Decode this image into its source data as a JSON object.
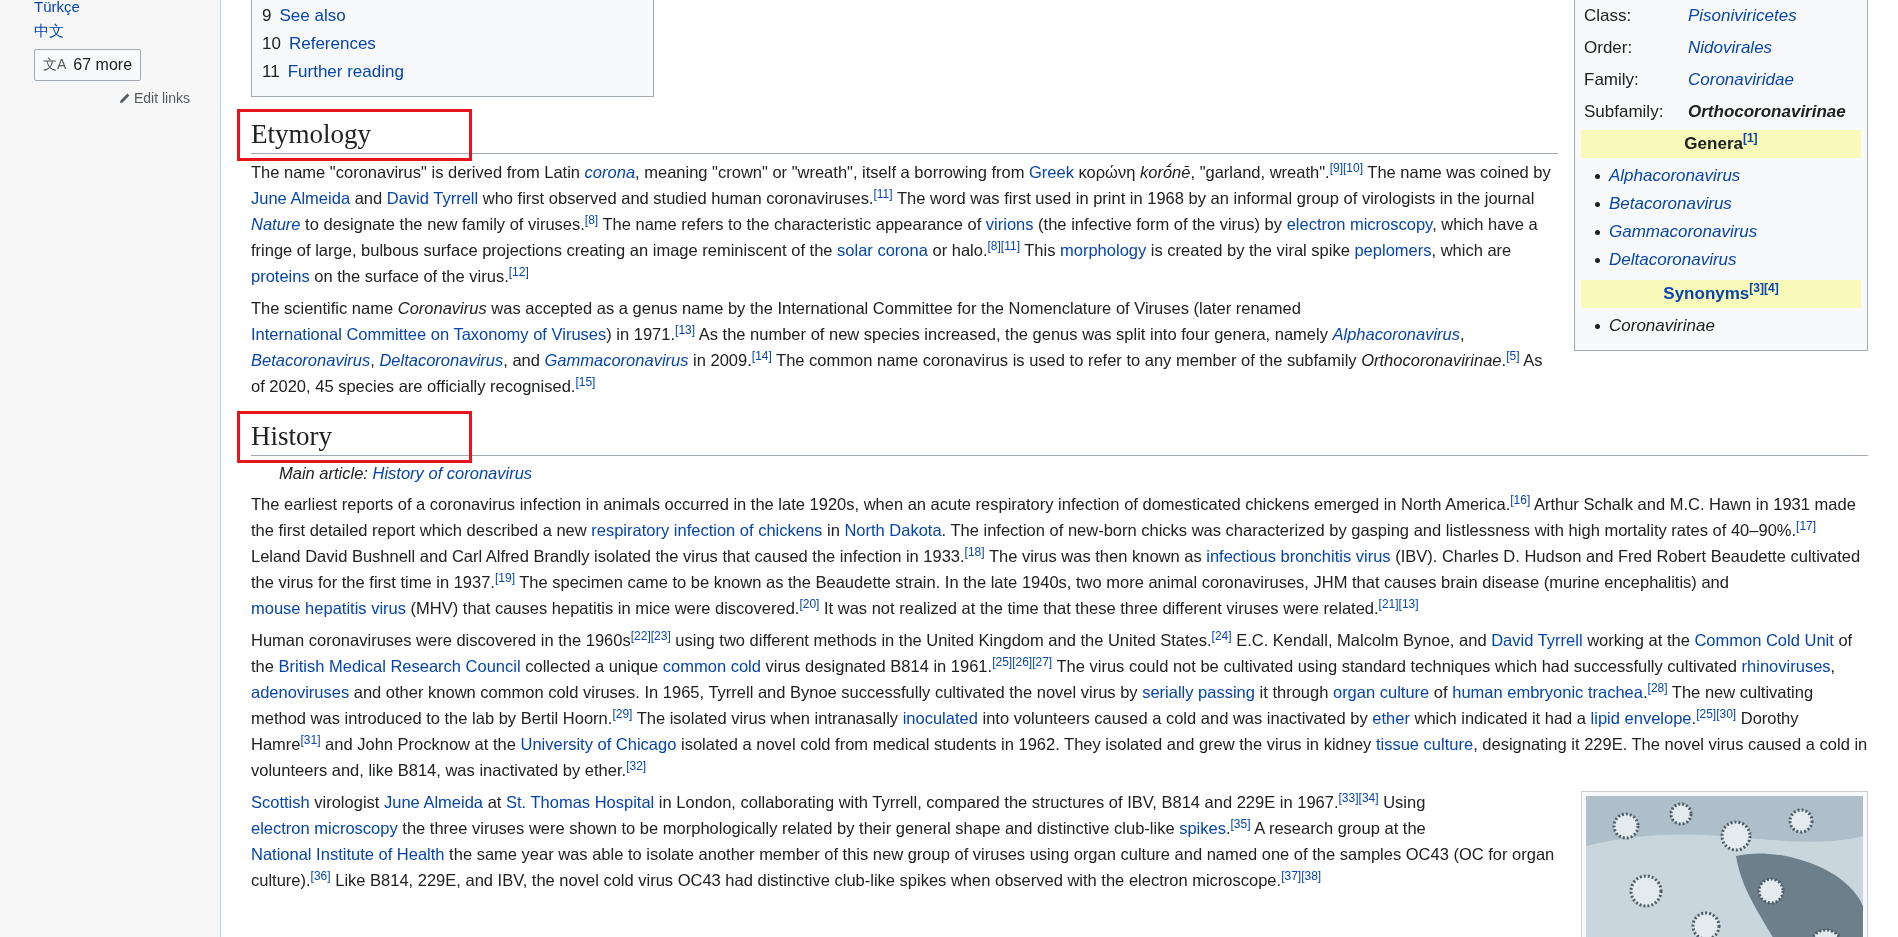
{
  "sidebar": {
    "languages": [
      {
        "label": "Türkçe"
      },
      {
        "label": "中文"
      }
    ],
    "more_button": {
      "icon": "文A",
      "label": "67 more"
    },
    "edit_links": {
      "label": "Edit links"
    }
  },
  "toc": {
    "items": [
      {
        "number": "9",
        "label": "See also"
      },
      {
        "number": "10",
        "label": "References"
      },
      {
        "number": "11",
        "label": "Further reading"
      }
    ]
  },
  "infobox": {
    "rows": [
      {
        "label": "Class:",
        "value": "Pisoniviricetes",
        "kind": "link"
      },
      {
        "label": "Order:",
        "value": "Nidovirales",
        "kind": "link"
      },
      {
        "label": "Family:",
        "value": "Coronaviridae",
        "kind": "link"
      },
      {
        "label": "Subfamily:",
        "value": "Orthocoronavirinae",
        "kind": "current"
      }
    ],
    "groups": [
      {
        "header": "Genera",
        "header_link": false,
        "cites": [
          "[1]"
        ],
        "items": [
          {
            "text": "Alphacoronavirus",
            "link": true
          },
          {
            "text": "Betacoronavirus",
            "link": true
          },
          {
            "text": "Gammacoronavirus",
            "link": true
          },
          {
            "text": "Deltacoronavirus",
            "link": true
          }
        ]
      },
      {
        "header": "Synonyms",
        "header_link": true,
        "cites": [
          "[3]",
          "[4]"
        ],
        "items": [
          {
            "text": "Coronavirinae",
            "link": false
          }
        ]
      }
    ]
  },
  "sections": [
    {
      "heading": {
        "text": "Etymology",
        "highlighted": true
      },
      "paragraphs": [
        {
          "runs": [
            {
              "kind": "text",
              "text": "The name \"coronavirus\" is derived from Latin "
            },
            {
              "kind": "link",
              "text": "corona",
              "italic": true
            },
            {
              "kind": "text",
              "text": ", meaning \"crown\" or \"wreath\", itself a borrowing from "
            },
            {
              "kind": "link",
              "text": "Greek"
            },
            {
              "kind": "text",
              "text": " κορώνη *korṓnē*, \"garland, wreath\"."
            },
            {
              "kind": "cite",
              "text": "[9]"
            },
            {
              "kind": "cite",
              "text": "[10]"
            },
            {
              "kind": "text",
              "text": " The name was coined by "
            },
            {
              "kind": "link",
              "text": "June Almeida"
            },
            {
              "kind": "text",
              "text": " and "
            },
            {
              "kind": "link",
              "text": "David Tyrrell"
            },
            {
              "kind": "text",
              "text": " who first observed and studied human coronaviruses."
            },
            {
              "kind": "cite",
              "text": "[11]"
            },
            {
              "kind": "text",
              "text": " The word was first used in print in 1968 by an informal group of virologists in the journal "
            },
            {
              "kind": "link",
              "text": "Nature",
              "italic": true
            },
            {
              "kind": "text",
              "text": " to designate the new family of viruses."
            },
            {
              "kind": "cite",
              "text": "[8]"
            },
            {
              "kind": "text",
              "text": " The name refers to the characteristic appearance of "
            },
            {
              "kind": "link",
              "text": "virions"
            },
            {
              "kind": "text",
              "text": " (the infective form of the virus) by "
            },
            {
              "kind": "link",
              "text": "electron microscopy"
            },
            {
              "kind": "text",
              "text": ", which have a fringe of large, bulbous surface projections creating an image reminiscent of the "
            },
            {
              "kind": "link",
              "text": "solar corona"
            },
            {
              "kind": "text",
              "text": " or halo."
            },
            {
              "kind": "cite",
              "text": "[8]"
            },
            {
              "kind": "cite",
              "text": "[11]"
            },
            {
              "kind": "text",
              "text": " This "
            },
            {
              "kind": "link",
              "text": "morphology"
            },
            {
              "kind": "text",
              "text": " is created by the viral spike "
            },
            {
              "kind": "link",
              "text": "peplomers"
            },
            {
              "kind": "text",
              "text": ", which are "
            },
            {
              "kind": "link",
              "text": "proteins"
            },
            {
              "kind": "text",
              "text": " on the surface of the virus."
            },
            {
              "kind": "cite",
              "text": "[12]"
            }
          ]
        },
        {
          "runs": [
            {
              "kind": "text",
              "text": "The scientific name *Coronavirus* was accepted as a genus name by the International Committee for the Nomenclature of Viruses (later renamed "
            },
            {
              "kind": "link",
              "text": "International Committee on Taxonomy of Viruses"
            },
            {
              "kind": "text",
              "text": ") in 1971."
            },
            {
              "kind": "cite",
              "text": "[13]"
            },
            {
              "kind": "text",
              "text": " As the number of new species increased, the genus was split into four genera, namely "
            },
            {
              "kind": "link",
              "text": "Alphacoronavirus",
              "italic": true
            },
            {
              "kind": "text",
              "text": ", "
            },
            {
              "kind": "link",
              "text": "Betacoronavirus",
              "italic": true
            },
            {
              "kind": "text",
              "text": ", "
            },
            {
              "kind": "link",
              "text": "Deltacoronavirus",
              "italic": true
            },
            {
              "kind": "text",
              "text": ", and "
            },
            {
              "kind": "link",
              "text": "Gammacoronavirus",
              "italic": true
            },
            {
              "kind": "text",
              "text": " in 2009."
            },
            {
              "kind": "cite",
              "text": "[14]"
            },
            {
              "kind": "text",
              "text": " The common name coronavirus is used to refer to any member of the subfamily *Orthocoronavirinae*."
            },
            {
              "kind": "cite",
              "text": "[5]"
            },
            {
              "kind": "text",
              "text": " As of 2020, 45 species are officially recognised."
            },
            {
              "kind": "cite",
              "text": "[15]"
            }
          ]
        }
      ]
    },
    {
      "heading": {
        "text": "History",
        "highlighted": true
      },
      "hatnote": {
        "label": "Main article:",
        "link": "History of coronavirus"
      },
      "paragraphs": [
        {
          "runs": [
            {
              "kind": "text",
              "text": "The earliest reports of a coronavirus infection in animals occurred in the late 1920s, when an acute respiratory infection of domesticated chickens emerged in North America."
            },
            {
              "kind": "cite",
              "text": "[16]"
            },
            {
              "kind": "text",
              "text": " Arthur Schalk and M.C. Hawn in 1931 made the first detailed report which described a new "
            },
            {
              "kind": "link",
              "text": "respiratory infection of chickens"
            },
            {
              "kind": "text",
              "text": " in "
            },
            {
              "kind": "link",
              "text": "North Dakota"
            },
            {
              "kind": "text",
              "text": ". The infection of new-born chicks was characterized by gasping and listlessness with high mortality rates of 40–90%."
            },
            {
              "kind": "cite",
              "text": "[17]"
            },
            {
              "kind": "text",
              "text": " Leland David Bushnell and Carl Alfred Brandly isolated the virus that caused the infection in 1933."
            },
            {
              "kind": "cite",
              "text": "[18]"
            },
            {
              "kind": "text",
              "text": " The virus was then known as "
            },
            {
              "kind": "link",
              "text": "infectious bronchitis virus"
            },
            {
              "kind": "text",
              "text": " (IBV). Charles D. Hudson and Fred Robert Beaudette cultivated the virus for the first time in 1937."
            },
            {
              "kind": "cite",
              "text": "[19]"
            },
            {
              "kind": "text",
              "text": " The specimen came to be known as the Beaudette strain. In the late 1940s, two more animal coronaviruses, JHM that causes brain disease (murine encephalitis) and "
            },
            {
              "kind": "link",
              "text": "mouse hepatitis virus"
            },
            {
              "kind": "text",
              "text": " (MHV) that causes hepatitis in mice were discovered."
            },
            {
              "kind": "cite",
              "text": "[20]"
            },
            {
              "kind": "text",
              "text": " It was not realized at the time that these three different viruses were related."
            },
            {
              "kind": "cite",
              "text": "[21]"
            },
            {
              "kind": "cite",
              "text": "[13]"
            }
          ]
        },
        {
          "runs": [
            {
              "kind": "text",
              "text": "Human coronaviruses were discovered in the 1960s"
            },
            {
              "kind": "cite",
              "text": "[22]"
            },
            {
              "kind": "cite",
              "text": "[23]"
            },
            {
              "kind": "text",
              "text": " using two different methods in the United Kingdom and the United States."
            },
            {
              "kind": "cite",
              "text": "[24]"
            },
            {
              "kind": "text",
              "text": " E.C. Kendall, Malcolm Bynoe, and "
            },
            {
              "kind": "link",
              "text": "David Tyrrell"
            },
            {
              "kind": "text",
              "text": " working at the "
            },
            {
              "kind": "link",
              "text": "Common Cold Unit"
            },
            {
              "kind": "text",
              "text": " of the "
            },
            {
              "kind": "link",
              "text": "British Medical Research Council"
            },
            {
              "kind": "text",
              "text": " collected a unique "
            },
            {
              "kind": "link",
              "text": "common cold"
            },
            {
              "kind": "text",
              "text": " virus designated B814 in 1961."
            },
            {
              "kind": "cite",
              "text": "[25]"
            },
            {
              "kind": "cite",
              "text": "[26]"
            },
            {
              "kind": "cite",
              "text": "[27]"
            },
            {
              "kind": "text",
              "text": " The virus could not be cultivated using standard techniques which had successfully cultivated "
            },
            {
              "kind": "link",
              "text": "rhinoviruses"
            },
            {
              "kind": "text",
              "text": ", "
            },
            {
              "kind": "link",
              "text": "adenoviruses"
            },
            {
              "kind": "text",
              "text": " and other known common cold viruses. In 1965, Tyrrell and Bynoe successfully cultivated the novel virus by "
            },
            {
              "kind": "link",
              "text": "serially passing"
            },
            {
              "kind": "text",
              "text": " it through "
            },
            {
              "kind": "link",
              "text": "organ culture"
            },
            {
              "kind": "text",
              "text": " of "
            },
            {
              "kind": "link",
              "text": "human embryonic trachea"
            },
            {
              "kind": "text",
              "text": "."
            },
            {
              "kind": "cite",
              "text": "[28]"
            },
            {
              "kind": "text",
              "text": " The new cultivating method was introduced to the lab by Bertil Hoorn."
            },
            {
              "kind": "cite",
              "text": "[29]"
            },
            {
              "kind": "text",
              "text": " The isolated virus when intranasally "
            },
            {
              "kind": "link",
              "text": "inoculated"
            },
            {
              "kind": "text",
              "text": " into volunteers caused a cold and was inactivated by "
            },
            {
              "kind": "link",
              "text": "ether"
            },
            {
              "kind": "text",
              "text": " which indicated it had a "
            },
            {
              "kind": "link",
              "text": "lipid envelope"
            },
            {
              "kind": "text",
              "text": "."
            },
            {
              "kind": "cite",
              "text": "[25]"
            },
            {
              "kind": "cite",
              "text": "[30]"
            },
            {
              "kind": "text",
              "text": " Dorothy Hamre"
            },
            {
              "kind": "cite",
              "text": "[31]"
            },
            {
              "kind": "text",
              "text": " and John Procknow at the "
            },
            {
              "kind": "link",
              "text": "University of Chicago"
            },
            {
              "kind": "text",
              "text": " isolated a novel cold from medical students in 1962. They isolated and grew the virus in kidney "
            },
            {
              "kind": "link",
              "text": "tissue culture"
            },
            {
              "kind": "text",
              "text": ", designating it 229E. The novel virus caused a cold in volunteers and, like B814, was inactivated by ether."
            },
            {
              "kind": "cite",
              "text": "[32]"
            }
          ]
        },
        {
          "runs": [
            {
              "kind": "link",
              "text": "Scottish"
            },
            {
              "kind": "text",
              "text": " virologist "
            },
            {
              "kind": "link",
              "text": "June Almeida"
            },
            {
              "kind": "text",
              "text": " at "
            },
            {
              "kind": "link",
              "text": "St. Thomas Hospital"
            },
            {
              "kind": "text",
              "text": " in London, collaborating with Tyrrell, compared the structures of IBV, B814 and 229E in 1967."
            },
            {
              "kind": "cite",
              "text": "[33]"
            },
            {
              "kind": "cite",
              "text": "[34]"
            },
            {
              "kind": "text",
              "text": " Using "
            },
            {
              "kind": "link",
              "text": "electron microscopy"
            },
            {
              "kind": "text",
              "text": " the three viruses were shown to be morphologically related by their general shape and distinctive club-like "
            },
            {
              "kind": "link",
              "text": "spikes"
            },
            {
              "kind": "text",
              "text": "."
            },
            {
              "kind": "cite",
              "text": "[35]"
            },
            {
              "kind": "text",
              "text": " A research group at the "
            },
            {
              "kind": "link",
              "text": "National Institute of Health"
            },
            {
              "kind": "text",
              "text": " the same year was able to isolate another member of this new group of viruses using organ culture and named one of the samples OC43 (OC for organ culture)."
            },
            {
              "kind": "cite",
              "text": "[36]"
            },
            {
              "kind": "text",
              "text": " Like B814, 229E, and IBV, the novel cold virus OC43 had distinctive club-like spikes when observed with the electron microscope."
            },
            {
              "kind": "cite",
              "text": "[37]"
            },
            {
              "kind": "cite",
              "text": "[38]"
            }
          ]
        }
      ]
    }
  ]
}
